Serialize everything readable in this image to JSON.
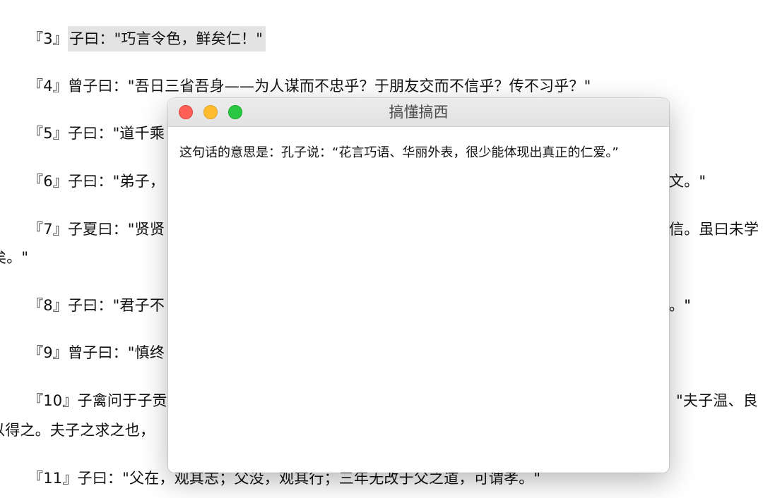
{
  "document": {
    "lines": [
      {
        "pre": "『3』",
        "hl": "子曰：\"巧言令色，鲜矣仁！\"",
        "post": ""
      },
      {
        "pre": "『4』",
        "hl": "",
        "post": "曾子曰：\"吾日三省吾身——为人谋而不忠乎？于朋友交而不信乎？传不习乎？\""
      },
      {
        "pre": "『5』",
        "hl": "",
        "post": "子曰：\"道千乘"
      },
      {
        "pre": "『6』",
        "hl": "",
        "post": "子曰：\"弟子，"
      },
      {
        "pre": "",
        "hl": "",
        "post": "文。\""
      },
      {
        "pre": "『7』",
        "hl": "",
        "post": "子夏曰：\"贤贤"
      },
      {
        "pre": "",
        "hl": "",
        "post": "信。虽曰未学"
      },
      {
        "pre": "",
        "hl": "",
        "post": "矣。\""
      },
      {
        "pre": "『8』",
        "hl": "",
        "post": "子曰：\"君子不"
      },
      {
        "pre": "",
        "hl": "",
        "post": "。\""
      },
      {
        "pre": "『9』",
        "hl": "",
        "post": "曾子曰：\"慎终"
      },
      {
        "pre": "『10』",
        "hl": "",
        "post": "子禽问于子贡"
      },
      {
        "pre": "",
        "hl": "",
        "post": "\"夫子温、良"
      },
      {
        "pre": "",
        "hl": "",
        "post": "以得之。夫子之求之也，"
      },
      {
        "pre": "『11』",
        "hl": "",
        "post": "子曰：\"父在，观其志；父没，观其行；三年无改于父之道，可谓孝。\""
      }
    ]
  },
  "window": {
    "title": "搞懂搞西",
    "body": "这句话的意思是：孔子说：“花言巧语、华丽外表，很少能体现出真正的仁爱。”"
  },
  "colors": {
    "highlight": "#e3e3e3",
    "close": "#fe5f57",
    "minimize": "#febc2e",
    "maximize": "#28c840"
  }
}
